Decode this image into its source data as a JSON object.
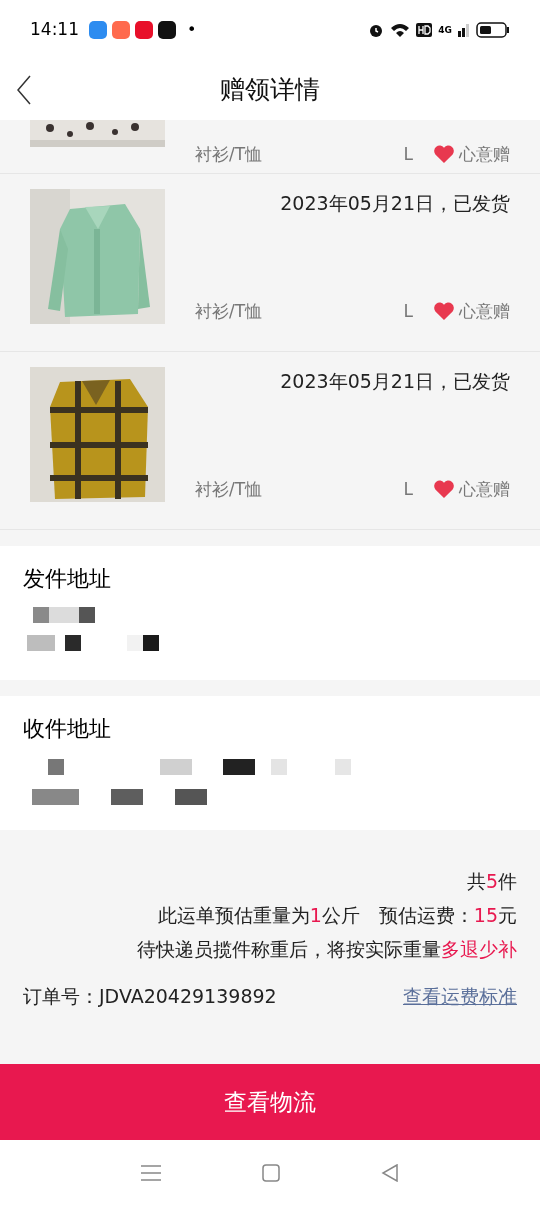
{
  "status_bar": {
    "time": "14:11",
    "dot": "•",
    "network": "4G"
  },
  "header": {
    "title": "赠领详情"
  },
  "items": [
    {
      "category": "衬衫/T恤",
      "size": "L",
      "badge": "心意赠"
    },
    {
      "date": "2023年05月21日，已发货",
      "category": "衬衫/T恤",
      "size": "L",
      "badge": "心意赠"
    },
    {
      "date": "2023年05月21日，已发货",
      "category": "衬衫/T恤",
      "size": "L",
      "badge": "心意赠"
    }
  ],
  "sender": {
    "title": "发件地址"
  },
  "receiver": {
    "title": "收件地址"
  },
  "summary": {
    "count": [
      {
        "text": "共",
        "emphasis": false
      },
      {
        "text": "5",
        "emphasis": true
      },
      {
        "text": "件",
        "emphasis": false
      }
    ],
    "weight": [
      {
        "text": "此运单预估重量为",
        "emphasis": false
      },
      {
        "text": "1",
        "emphasis": true
      },
      {
        "text": "公斤　预估运费：",
        "emphasis": false
      },
      {
        "text": "15",
        "emphasis": true
      },
      {
        "text": "元",
        "emphasis": false
      }
    ],
    "note": [
      {
        "text": "待快递员揽件称重后，将按实际重量",
        "emphasis": false
      },
      {
        "text": "多退少补",
        "emphasis": true
      }
    ],
    "order_label": "订单号：JDVA20429139892",
    "fee_link": "查看运费标准"
  },
  "action_button": "查看物流"
}
